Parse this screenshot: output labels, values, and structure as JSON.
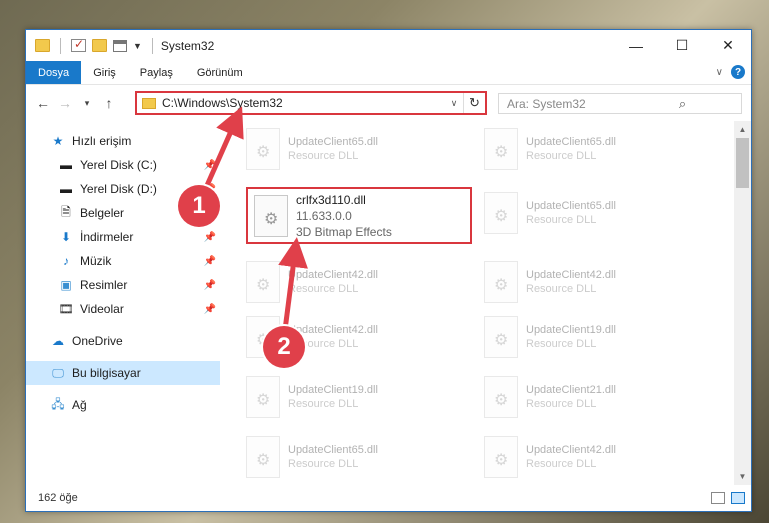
{
  "window": {
    "title": "System32"
  },
  "ribbon": {
    "tabs": [
      "Dosya",
      "Giriş",
      "Paylaş",
      "Görünüm"
    ]
  },
  "address": {
    "path": "C:\\Windows\\System32"
  },
  "search": {
    "placeholder": "Ara: System32"
  },
  "nav": {
    "quick_access": "Hızlı erişim",
    "items": [
      {
        "label": "Yerel Disk (C:)",
        "pinned": true
      },
      {
        "label": "Yerel Disk (D:)",
        "pinned": true
      },
      {
        "label": "Belgeler",
        "pinned": true
      },
      {
        "label": "İndirmeler",
        "pinned": true
      },
      {
        "label": "Müzik",
        "pinned": true
      },
      {
        "label": "Resimler",
        "pinned": true
      },
      {
        "label": "Videolar",
        "pinned": true
      }
    ],
    "onedrive": "OneDrive",
    "this_pc": "Bu bilgisayar",
    "network": "Ağ"
  },
  "files": {
    "highlighted": {
      "name": "crlfx3d110.dll",
      "version": "11.633.0.0",
      "desc": "3D Bitmap Effects"
    },
    "left_col": [
      {
        "name": "UpdateClient65.dll",
        "type": "Resource DLL"
      },
      {
        "name": "UpdateClient42.dll",
        "type": "Resource DLL"
      },
      {
        "name": "UpdateClient42.dll",
        "type": "Resource DLL"
      },
      {
        "name": "UpdateClient19.dll",
        "type": "Resource DLL"
      },
      {
        "name": "UpdateClient65.dll",
        "type": "Resource DLL"
      }
    ],
    "right_col": [
      {
        "name": "UpdateClient65.dll",
        "type": "Resource DLL"
      },
      {
        "name": "UpdateClient65.dll",
        "type": "Resource DLL"
      },
      {
        "name": "UpdateClient42.dll",
        "type": "Resource DLL"
      },
      {
        "name": "UpdateClient19.dll",
        "type": "Resource DLL"
      },
      {
        "name": "UpdateClient21.dll",
        "type": "Resource DLL"
      },
      {
        "name": "UpdateClient42.dll",
        "type": "Resource DLL"
      }
    ]
  },
  "status": {
    "count": "162 öğe"
  },
  "callouts": [
    "1",
    "2"
  ],
  "colors": {
    "accent": "#1979ca",
    "highlight": "#d9363e",
    "callout": "#e0404a"
  }
}
